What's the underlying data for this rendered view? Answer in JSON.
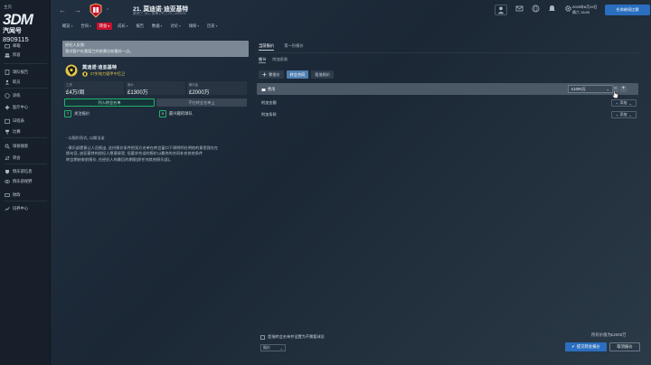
{
  "sidebar": {
    "home_label": "主页",
    "logo_top": "3DM",
    "logo_sub": "汽闻号",
    "logo_number": "8909115",
    "items": [
      {
        "label": "邮箱",
        "icon": "inbox-icon"
      },
      {
        "label": "阵容",
        "icon": "squad-icon"
      },
      {
        "label": "球队报告",
        "icon": "report-icon"
      },
      {
        "label": "职员",
        "icon": "staff-icon"
      },
      {
        "label": "训练",
        "icon": "training-icon"
      },
      {
        "label": "医疗中心",
        "icon": "medical-icon"
      },
      {
        "label": "日程表",
        "icon": "calendar-icon"
      },
      {
        "label": "比赛",
        "icon": "competition-icon"
      },
      {
        "label": "球探搜索",
        "icon": "scouting-icon"
      },
      {
        "label": "转会",
        "icon": "transfers-icon"
      },
      {
        "label": "俱乐部信息",
        "icon": "club-info-icon"
      },
      {
        "label": "俱乐部视野",
        "icon": "club-vision-icon"
      },
      {
        "label": "财政",
        "icon": "finances-icon"
      },
      {
        "label": "培养中心",
        "icon": "development-icon"
      }
    ]
  },
  "header": {
    "back_icon": "←",
    "forward_icon": "→",
    "club_title": "21. 莫迪诺·迪亚基特",
    "club_subtitle": "桑德兰 (B) | 前锋 (中) | 25 | 4/06/05",
    "date_line1": "2025年6月19日",
    "date_line2": "周六 15:00",
    "continue_label": "任命继续比赛"
  },
  "menu": [
    {
      "label": "概览",
      "caret": true,
      "active": false
    },
    {
      "label": "合同",
      "caret": true,
      "active": false
    },
    {
      "label": "转会",
      "caret": true,
      "active": true
    },
    {
      "label": "成长",
      "caret": true,
      "active": false
    },
    {
      "label": "报告",
      "caret": false,
      "active": false
    },
    {
      "label": "数据",
      "caret": true,
      "active": false
    },
    {
      "label": "讨论",
      "caret": true,
      "active": false
    },
    {
      "label": "球探",
      "caret": true,
      "active": false
    },
    {
      "label": "历史",
      "caret": true,
      "active": false
    }
  ],
  "notice": {
    "title": "经纪人反馈:",
    "body": "我对客户在桑德兰的前景比较看好一点。"
  },
  "player": {
    "name": "莫迪诺·迪亚基特",
    "age_text": "27岁效力德甲中后卫",
    "stats": [
      {
        "label": "工资",
        "value": "£4万/周"
      },
      {
        "label": "身价",
        "value": "£1300万"
      },
      {
        "label": "解约金",
        "value": "£2000万"
      }
    ],
    "btn_shortlist": "列入转会名单",
    "btn_unlist": "不在转会名单上",
    "options": [
      {
        "key": "7",
        "label": "关注报价"
      },
      {
        "key": "5",
        "label": "最兴趣的球队"
      }
    ]
  },
  "description": {
    "line0": "- 以报价形式, 以做法谈",
    "p1": "- 俱乐部愿意让人员报出, 这份报价条件把双方名单在转会窗口下周明明在明他的意思我在在",
    "p2": "换句话, 迪亚基特的经纪人愿意接受, 但要求合适的报价以最终的合同补充其他条件",
    "p3": "转会期结束前报价, 在经纪人的最后的期限(即任何其他俱乐部)。"
  },
  "right": {
    "tabs": [
      "当前报价",
      "第一份报价"
    ],
    "subtabs": [
      "细节",
      "附加条款"
    ],
    "pills": [
      {
        "label": "零报价",
        "active": false
      },
      {
        "label": "转会合同",
        "active": true
      },
      {
        "label": "租借报价",
        "active": false
      }
    ],
    "fee_label": "费用",
    "fee_value": "£1000万",
    "clauses": [
      "附加金额",
      "附加条款"
    ],
    "add_label": "添加"
  },
  "footer": {
    "save_label": "是指转会名单并设置为不需要球员",
    "select_label": "报价",
    "all_value": "所有价值为£2000万",
    "submit_label": "提交转会报价",
    "cancel_label": "取消报价"
  }
}
